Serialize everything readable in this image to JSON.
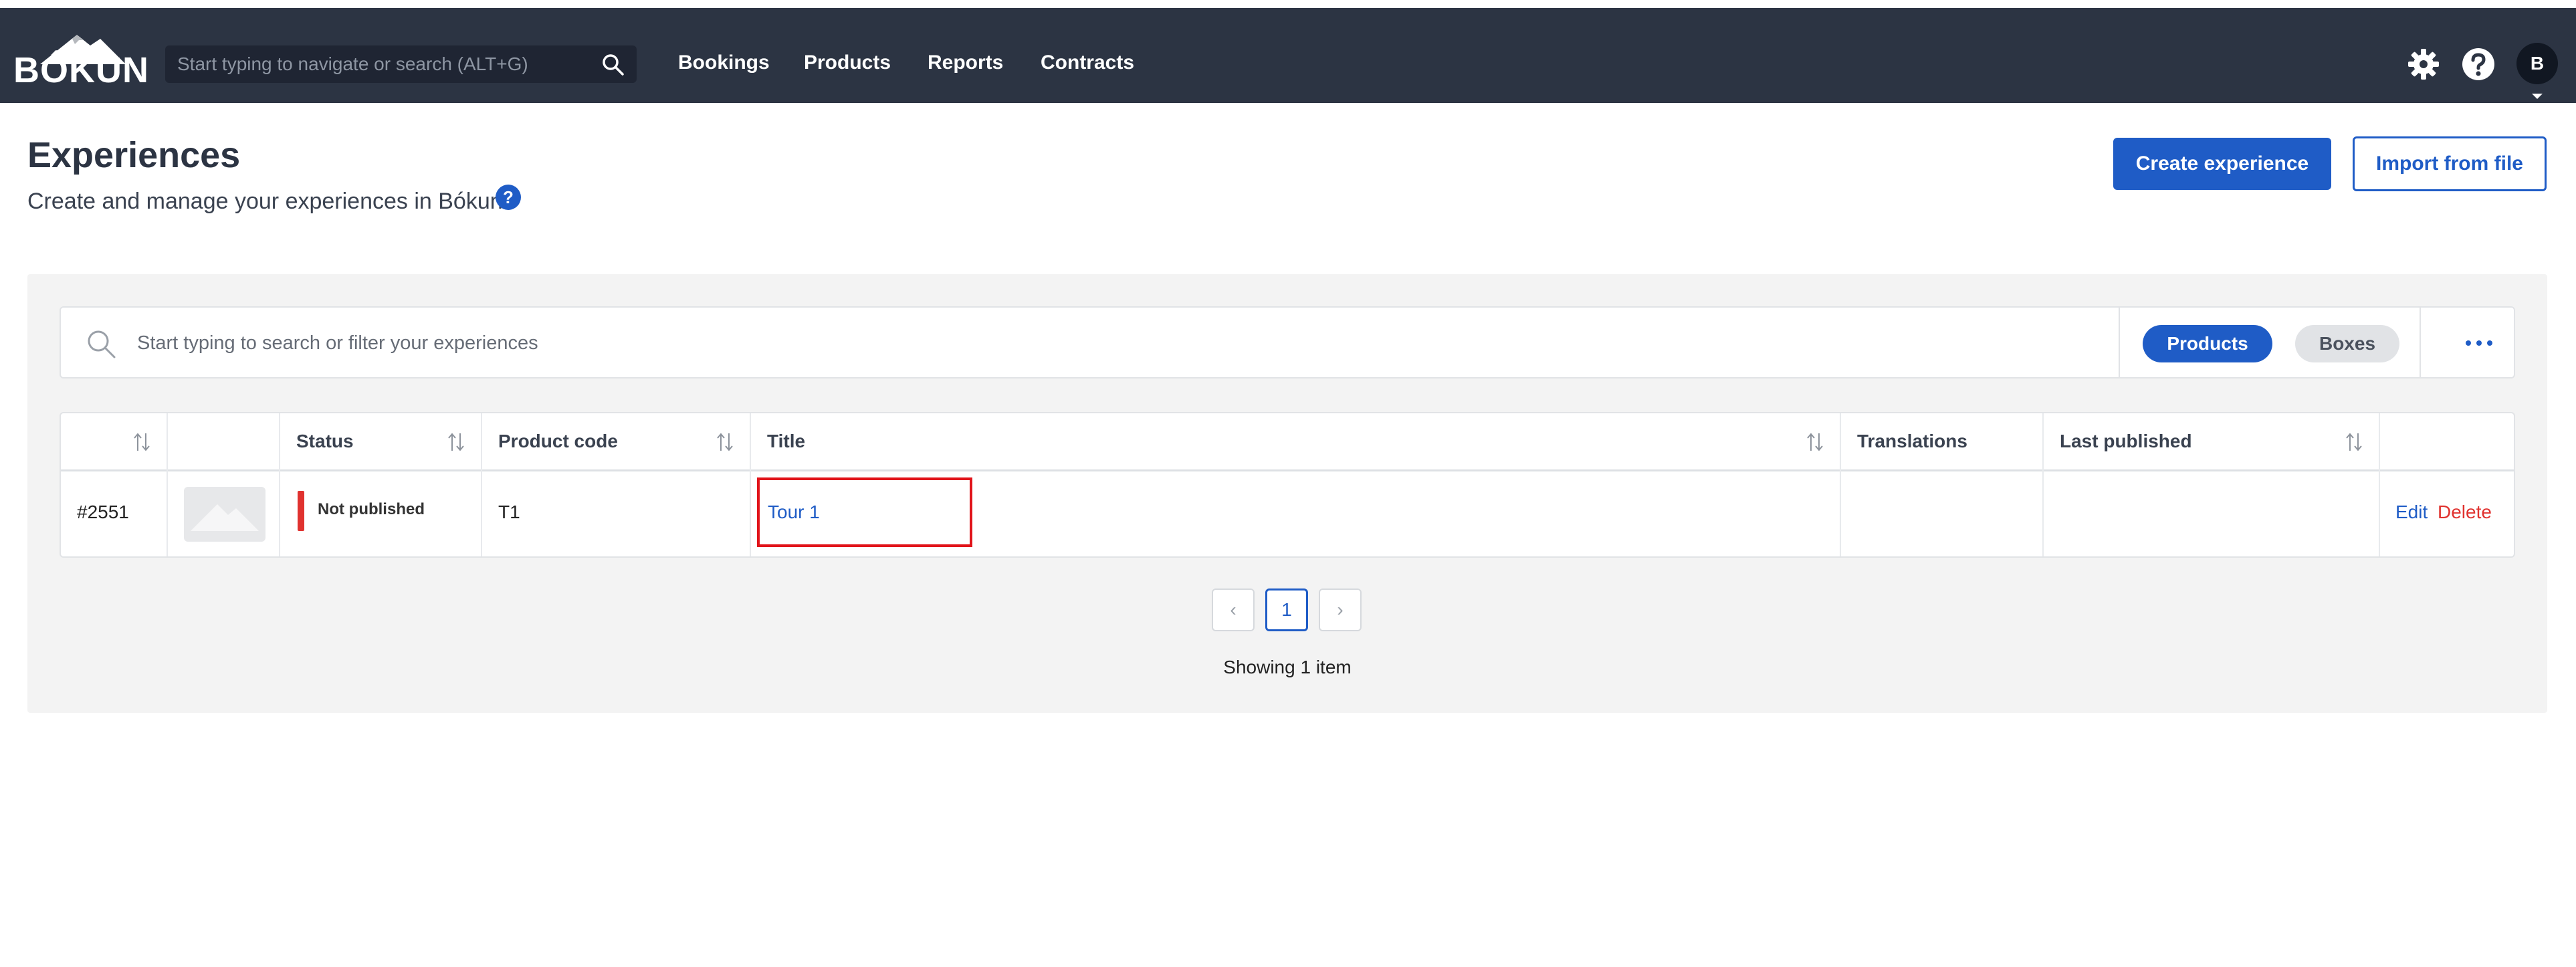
{
  "app": {
    "logo_text": "BÓKUN"
  },
  "nav": {
    "search_placeholder": "Start typing to navigate or search (ALT+G)",
    "links": [
      "Bookings",
      "Products",
      "Reports",
      "Contracts"
    ],
    "avatar_initial": "B"
  },
  "header": {
    "title": "Experiences",
    "subtitle": "Create and manage your experiences in Bókun.",
    "help_glyph": "?",
    "create_button": "Create experience",
    "import_button": "Import from file"
  },
  "filter": {
    "placeholder": "Start typing to search or filter your experiences",
    "toggles": [
      {
        "label": "Products",
        "active": true
      },
      {
        "label": "Boxes",
        "active": false
      }
    ]
  },
  "table": {
    "columns": [
      "",
      "",
      "Status",
      "Product code",
      "Title",
      "Translations",
      "Last published",
      ""
    ],
    "rows": [
      {
        "id": "#2551",
        "status": "Not published",
        "product_code": "T1",
        "title": "Tour 1",
        "translations": "",
        "last_published": "",
        "actions": {
          "edit": "Edit",
          "delete": "Delete"
        }
      }
    ]
  },
  "pagination": {
    "prev": "‹",
    "current_page": "1",
    "next": "›",
    "summary": "Showing 1 item"
  },
  "colors": {
    "nav_bg": "#2c3443",
    "primary": "#1f5cc6",
    "danger": "#e0322f",
    "panel_bg": "#f3f3f3"
  },
  "icons": {
    "nav_search": "search-icon",
    "settings": "gear-icon",
    "help": "help-icon",
    "sort": "sort-icon",
    "more": "more-horizontal-icon",
    "image_placeholder": "image-placeholder-icon"
  }
}
